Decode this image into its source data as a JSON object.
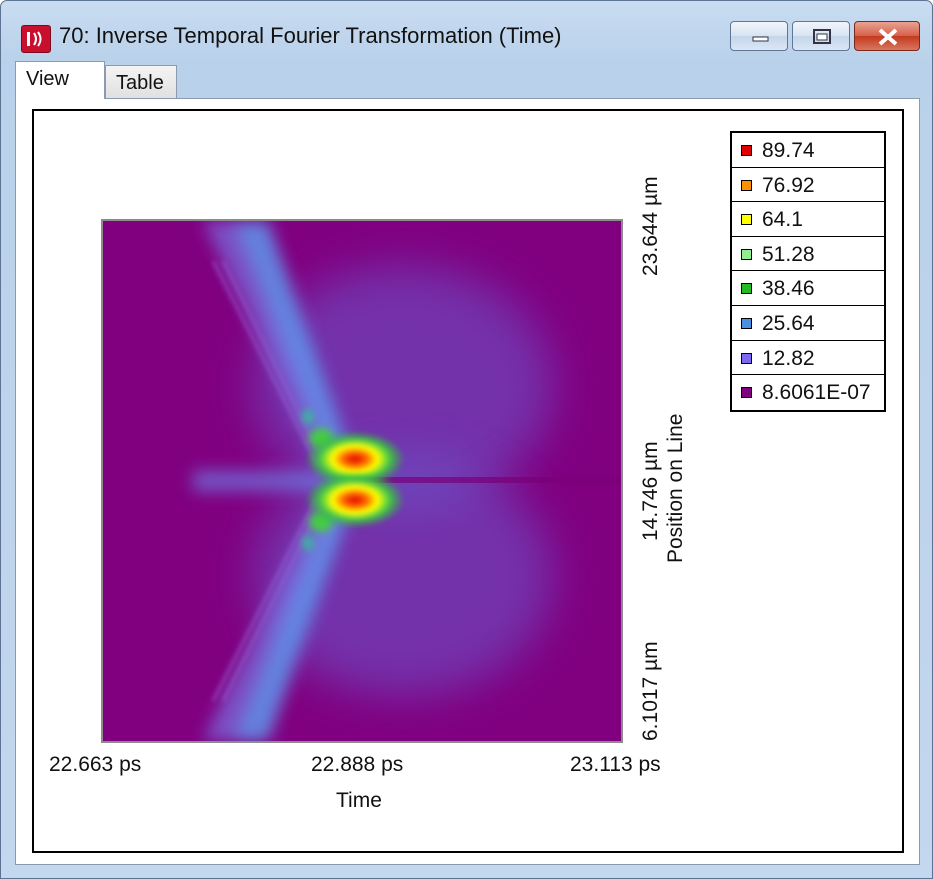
{
  "window": {
    "title": "70: Inverse Temporal Fourier Transformation (Time)"
  },
  "tabs": [
    {
      "label": "View"
    },
    {
      "label": "Table"
    }
  ],
  "plot": {
    "x_axis": {
      "label": "Time",
      "ticks": [
        "22.663 ps",
        "22.888 ps",
        "23.113 ps"
      ]
    },
    "y_axis": {
      "label": "Position on Line",
      "ticks": [
        "6.1017 µm",
        "14.746 µm",
        "23.644 µm"
      ]
    }
  },
  "legend": {
    "items": [
      {
        "label": "89.74",
        "color": "#e00000"
      },
      {
        "label": "76.92",
        "color": "#ff9000"
      },
      {
        "label": "64.1",
        "color": "#ffff00"
      },
      {
        "label": "51.28",
        "color": "#90ee90"
      },
      {
        "label": "38.46",
        "color": "#22bb22"
      },
      {
        "label": "25.64",
        "color": "#4a90e2"
      },
      {
        "label": "12.82",
        "color": "#7b68ee"
      },
      {
        "label": "8.6061E-07",
        "color": "#800080"
      }
    ]
  },
  "chart_data": {
    "type": "heatmap",
    "title": "",
    "xlabel": "Time",
    "ylabel": "Position on Line",
    "x_ticks": [
      "22.663 ps",
      "22.888 ps",
      "23.113 ps"
    ],
    "y_ticks": [
      "6.1017 µm",
      "14.746 µm",
      "23.644 µm"
    ],
    "color_levels": [
      89.74,
      76.92,
      64.1,
      51.28,
      38.46,
      25.64,
      12.82,
      8.6061e-07
    ],
    "peaks": [
      {
        "x": 22.879,
        "y": 15.8,
        "value": 89.74
      },
      {
        "x": 22.879,
        "y": 13.3,
        "value": 89.74
      }
    ]
  }
}
